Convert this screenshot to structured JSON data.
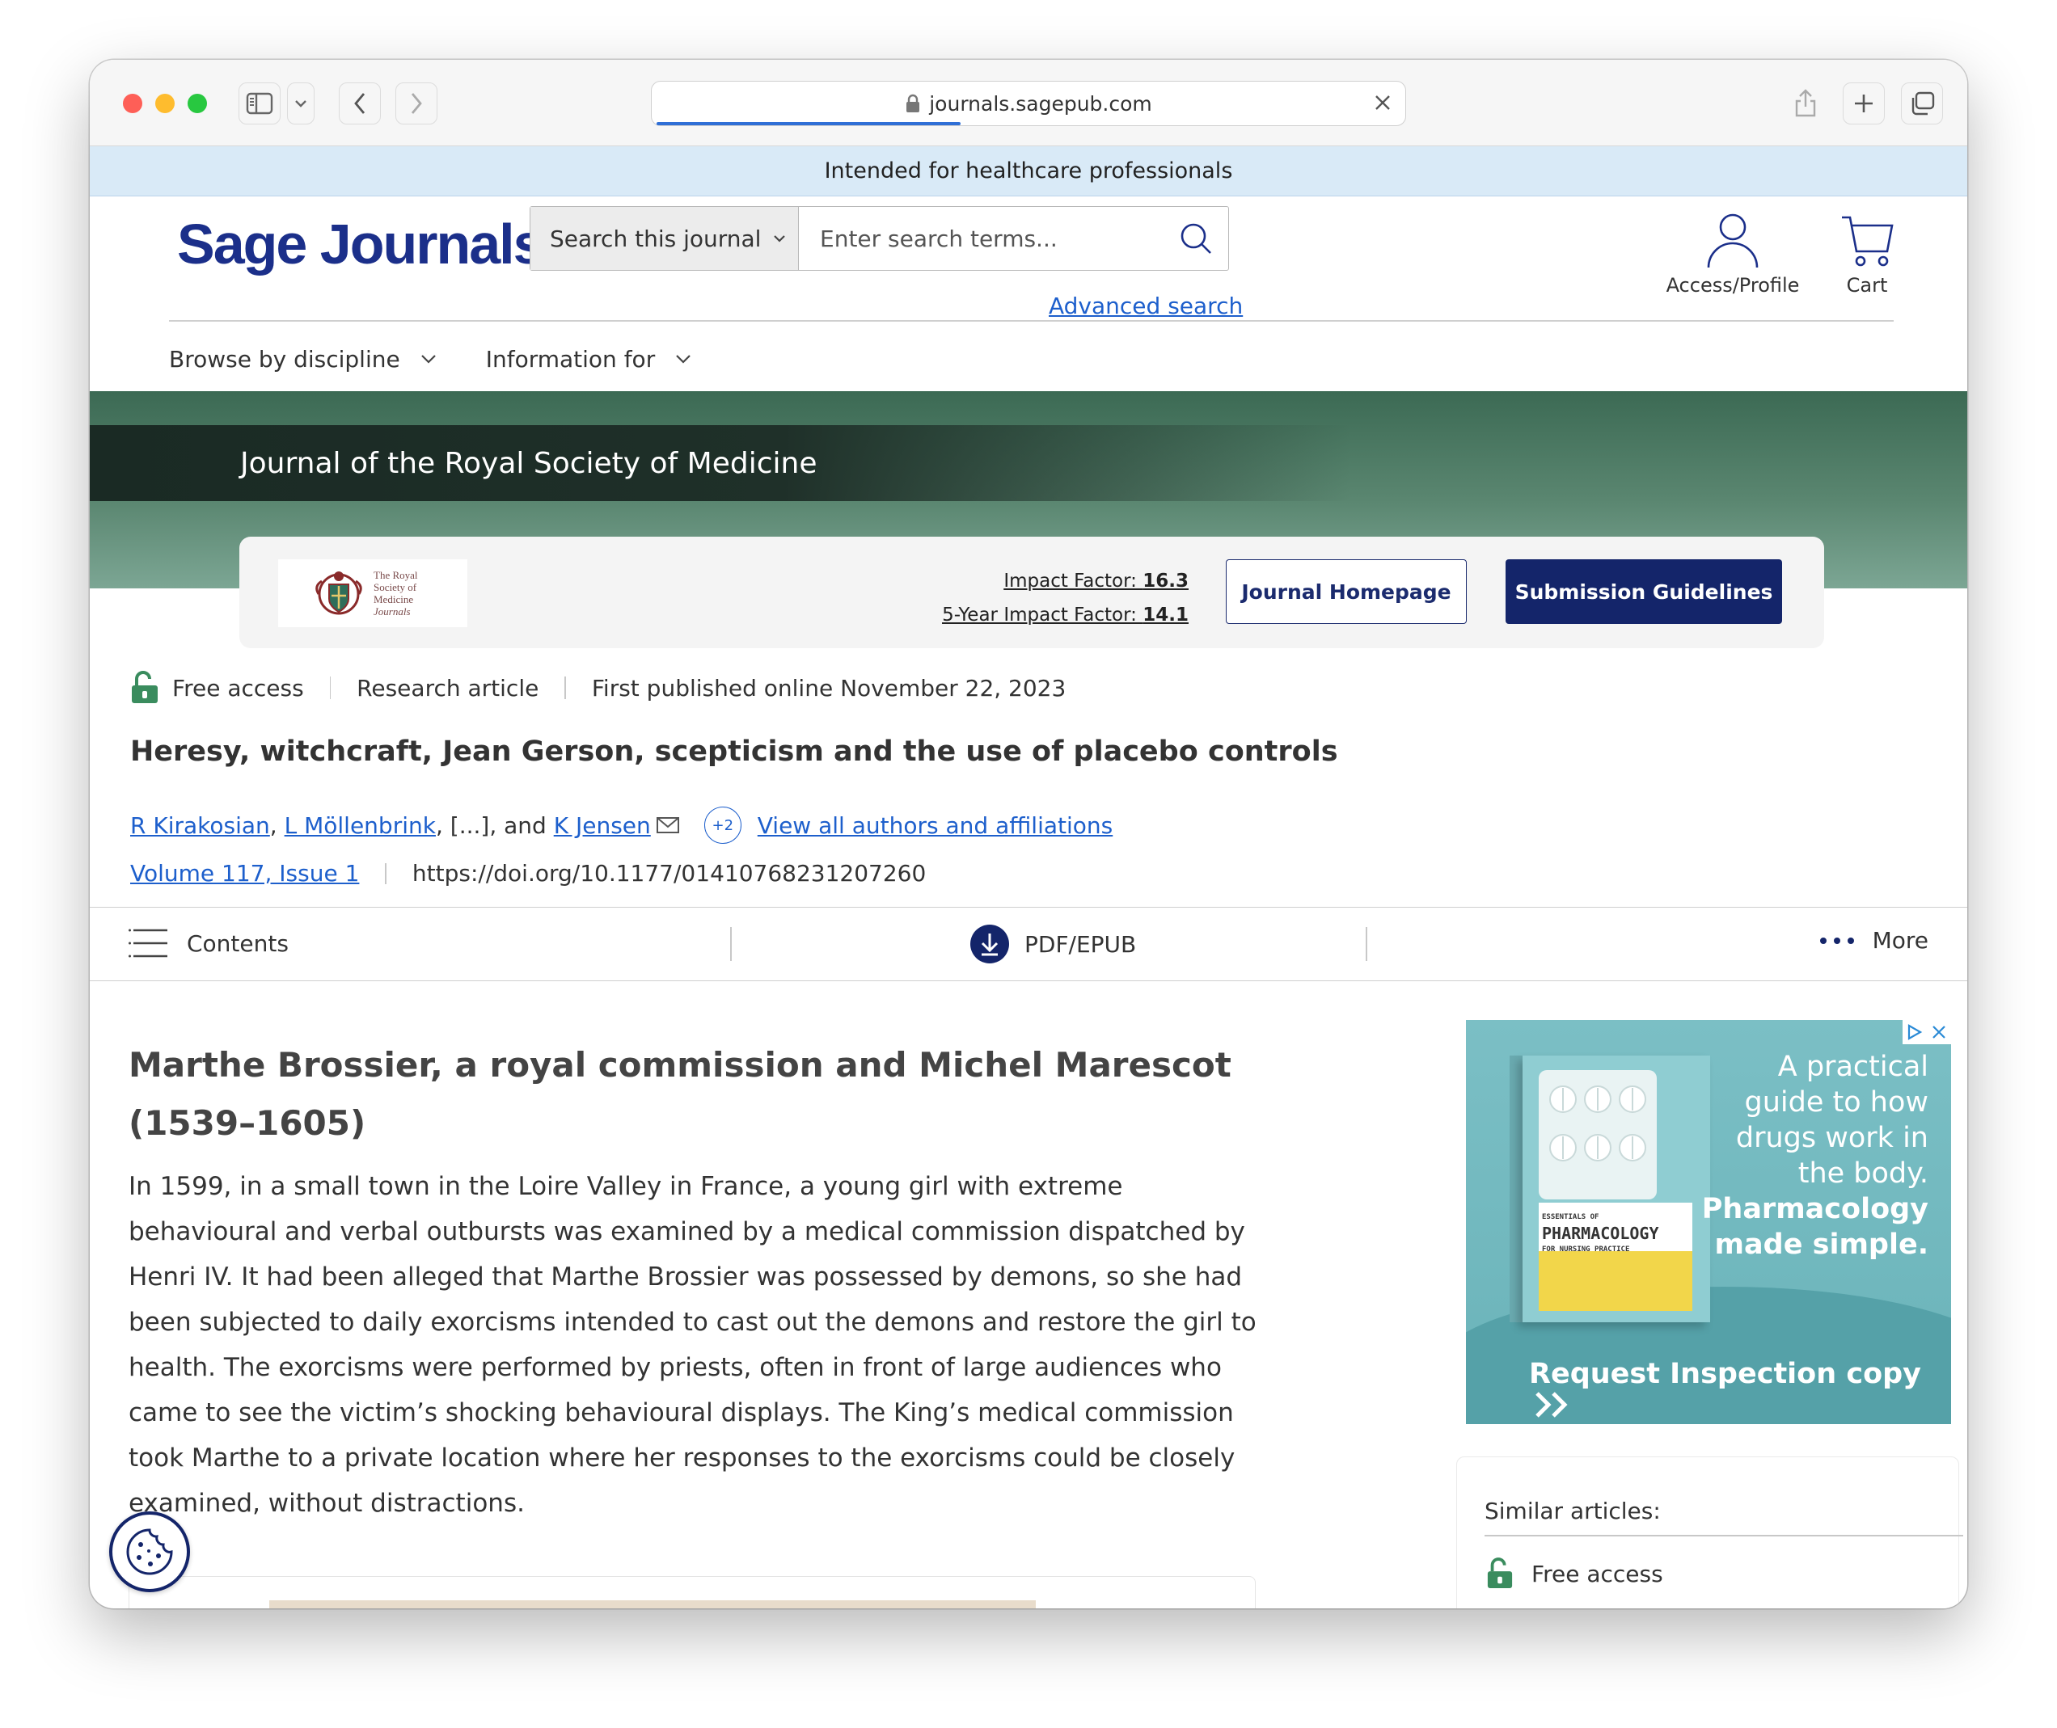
{
  "browser": {
    "url": "journals.sagepub.com"
  },
  "banner": {
    "text": "Intended for healthcare professionals"
  },
  "header": {
    "logo": "Sage Journals",
    "search_scope": "Search this journal",
    "search_placeholder": "Enter search terms...",
    "advanced_search": "Advanced search",
    "access_profile": "Access/Profile",
    "cart": "Cart"
  },
  "nav": {
    "items": [
      {
        "label": "Browse by discipline"
      },
      {
        "label": "Information for"
      }
    ]
  },
  "journal": {
    "name": "Journal of the Royal Society of Medicine",
    "logo_lines": [
      "The Royal",
      "Society of",
      "Medicine",
      "Journals"
    ],
    "impact_label": "Impact Factor:",
    "impact_value": "16.3",
    "five_year_label": "5-Year Impact Factor:",
    "five_year_value": "14.1",
    "homepage_button": "Journal Homepage",
    "submission_button": "Submission Guidelines"
  },
  "article": {
    "access": "Free access",
    "type": "Research article",
    "published": "First published online November 22, 2023",
    "title": "Heresy, witchcraft, Jean Gerson, scepticism and the use of placebo controls",
    "authors": {
      "a1": "R Kirakosian",
      "sep1": ", ",
      "a2": "L Möllenbrink",
      "ellipsis": ", [...], and ",
      "a3": "K Jensen",
      "more_count": "+2",
      "view_all": "View all authors and affiliations"
    },
    "volume": "Volume 117, Issue 1",
    "doi": "https://doi.org/10.1177/01410768231207260"
  },
  "actionbar": {
    "contents": "Contents",
    "pdf": "PDF/EPUB",
    "more": "More"
  },
  "body": {
    "section_heading": "Marthe Brossier, a royal commission and Michel Marescot (1539–1605)",
    "paragraph": "In 1599, in a small town in the Loire Valley in France, a young girl with extreme behavioural and verbal outbursts was examined by a medical commission dispatched by Henri IV. It had been alleged that Marthe Brossier was possessed by demons, so she had been subjected to daily exorcisms intended to cast out the demons and restore the girl to health. The exorcisms were performed by priests, often in front of large audiences who came to see the victim’s shocking behavioural displays. The King’s medical commission took Marthe to a private location where her responses to the exorcisms could be closely examined, without distractions."
  },
  "ad": {
    "line1": "A practical",
    "line2": "guide to how",
    "line3": "drugs work in",
    "line4": "the body.",
    "line5": "Pharmacology",
    "line6": "made simple.",
    "book_title": "PHARMACOLOGY",
    "book_prefix": "ESSENTIALS OF",
    "book_suffix": "FOR NURSING PRACTICE",
    "cta": "Request Inspection copy"
  },
  "sidebar": {
    "similar_title": "Similar articles:",
    "first_item_access": "Free access"
  },
  "colors": {
    "brand_navy": "#14256a",
    "link_blue": "#1d5fcc",
    "journal_green": "#3c6a54",
    "open_access_green": "#3a8c5e"
  }
}
